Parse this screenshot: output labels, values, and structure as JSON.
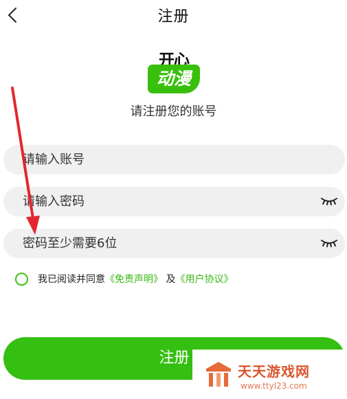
{
  "header": {
    "title": "注册",
    "back_icon": "chevron-left-icon"
  },
  "logo": {
    "top_text": "开心",
    "badge_text": "动漫",
    "brand_color": "#39c00c"
  },
  "subtitle": "请注册您的账号",
  "fields": {
    "account": {
      "placeholder": "请输入账号",
      "value": ""
    },
    "password": {
      "placeholder": "请输入密码",
      "value": "",
      "icon": "eye-closed-icon"
    },
    "password_hint": {
      "placeholder": "密码至少需要6位",
      "value": "",
      "icon": "eye-closed-icon"
    }
  },
  "agreement": {
    "prefix": "我已阅读并同意",
    "disclaimer": "《免责声明》",
    "conjunction": "及",
    "user_agreement": "《用户协议》",
    "checked": false
  },
  "register_button": {
    "label": "注册"
  },
  "watermark": {
    "title": "天天游戏网",
    "url": "www.ttyl23.com"
  },
  "colors": {
    "accent": "#35bf12",
    "field_bg": "#f0f0f0",
    "arrow": "#e3262e"
  }
}
